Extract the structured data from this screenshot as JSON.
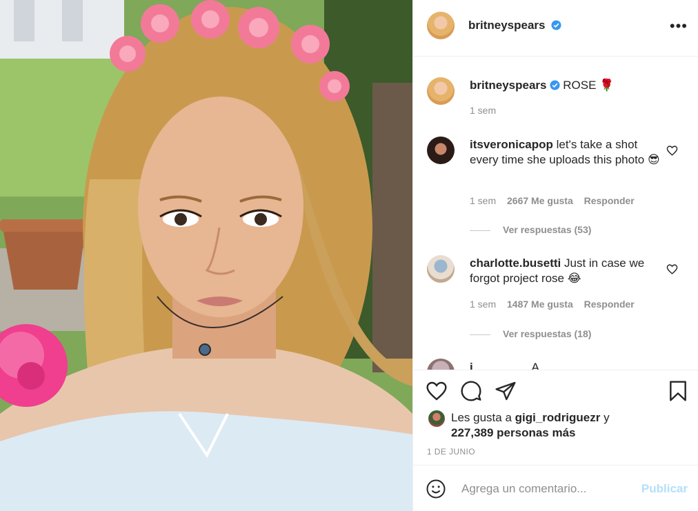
{
  "post": {
    "photo_alt": "selfie with flower crown",
    "author": "britneyspears",
    "caption": "ROSE 🌹",
    "caption_time": "1 sem"
  },
  "comments": [
    {
      "user": "itsveronicapop",
      "text": "let's take a shot every time she uploads this photo 😎",
      "time": "1 sem",
      "likes": "2667 Me gusta",
      "reply": "Responder",
      "view_replies": "Ver respuestas (53)"
    },
    {
      "user": "charlotte.busetti",
      "text": "Just in case we forgot project rose 😂",
      "time": "1 sem",
      "likes": "1487 Me gusta",
      "reply": "Responder",
      "view_replies": "Ver respuestas (18)"
    }
  ],
  "cutoff_comment": {
    "user": "i",
    "text": "A"
  },
  "likes": {
    "prefix": "Les gusta a",
    "user": "gigi_rodriguezr",
    "conj": "y",
    "count": "227,389 personas más"
  },
  "date": "1 DE JUNIO",
  "composer": {
    "placeholder": "Agrega un comentario...",
    "publish": "Publicar"
  },
  "colors": {
    "verified": "#3897f0",
    "publish_disabled": "#b2dffc",
    "muted": "#8e8e8e"
  }
}
